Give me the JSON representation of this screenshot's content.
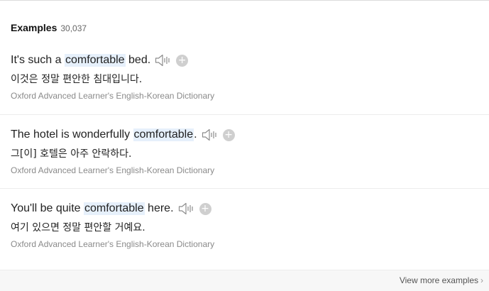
{
  "examples_section": {
    "title": "Examples",
    "count": "30,037",
    "items": [
      {
        "before": "It's such a ",
        "highlight": "comfortable",
        "after": " bed.",
        "translation": "이것은 정말 편안한 침대입니다.",
        "source": "Oxford Advanced Learner's English-Korean Dictionary"
      },
      {
        "before": "The hotel is wonderfully ",
        "highlight": "comfortable",
        "after": ".",
        "translation": "그[이] 호텔은 아주 안락하다.",
        "source": "Oxford Advanced Learner's English-Korean Dictionary"
      },
      {
        "before": "You'll be quite ",
        "highlight": "comfortable",
        "after": " here.",
        "translation": "여기 있으면 정말 편안할 거예요.",
        "source": "Oxford Advanced Learner's English-Korean Dictionary"
      }
    ],
    "view_more_label": "View more examples",
    "view_more_chevron": "›"
  },
  "icons": {
    "speaker": "speaker-icon",
    "add": "add-icon"
  },
  "colors": {
    "highlight_bg": "#e6f0fb",
    "source_text": "#8a8a8a",
    "add_button": "#cfcfcf"
  }
}
